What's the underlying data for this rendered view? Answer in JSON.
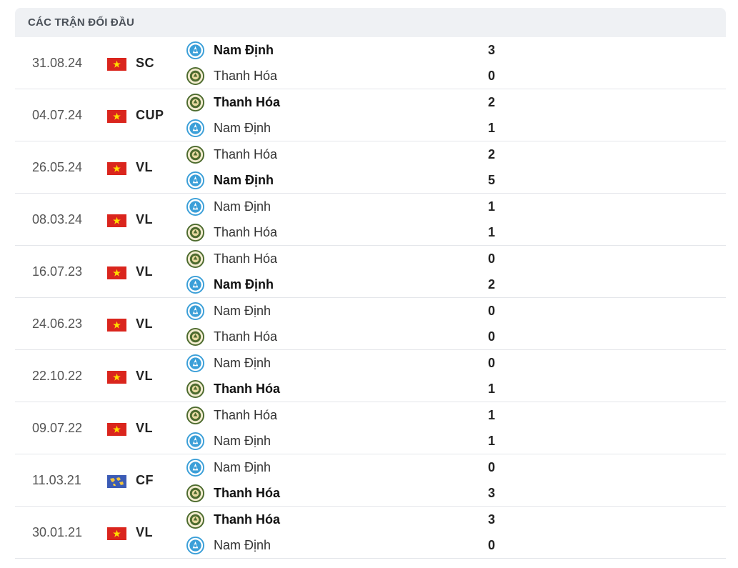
{
  "section": {
    "title": "CÁC TRẬN ĐỐI ĐẦU"
  },
  "teams": {
    "nam_dinh": {
      "name": "Nam Định",
      "logo_icon": "nam-dinh-logo-icon"
    },
    "thanh_hoa": {
      "name": "Thanh Hóa",
      "logo_icon": "thanh-hoa-logo-icon"
    }
  },
  "colors": {
    "vn_flag_red": "#da251d",
    "vn_flag_star": "#ffde00",
    "world_flag_blue": "#3b5bb5",
    "world_flag_gold": "#f2c53d",
    "nam_dinh_logo": "#3b9fd8",
    "thanh_hoa_logo": "#4d6b2e"
  },
  "matches": [
    {
      "date": "31.08.24",
      "flag": "vietnam-flag-icon",
      "competition": "SC",
      "home": {
        "team": "Nam Định",
        "logo": "nam_dinh",
        "score": "3",
        "winner": true
      },
      "away": {
        "team": "Thanh Hóa",
        "logo": "thanh_hoa",
        "score": "0",
        "winner": false
      }
    },
    {
      "date": "04.07.24",
      "flag": "vietnam-flag-icon",
      "competition": "CUP",
      "home": {
        "team": "Thanh Hóa",
        "logo": "thanh_hoa",
        "score": "2",
        "winner": true
      },
      "away": {
        "team": "Nam Định",
        "logo": "nam_dinh",
        "score": "1",
        "winner": false
      }
    },
    {
      "date": "26.05.24",
      "flag": "vietnam-flag-icon",
      "competition": "VL",
      "home": {
        "team": "Thanh Hóa",
        "logo": "thanh_hoa",
        "score": "2",
        "winner": false
      },
      "away": {
        "team": "Nam Định",
        "logo": "nam_dinh",
        "score": "5",
        "winner": true
      }
    },
    {
      "date": "08.03.24",
      "flag": "vietnam-flag-icon",
      "competition": "VL",
      "home": {
        "team": "Nam Định",
        "logo": "nam_dinh",
        "score": "1",
        "winner": false
      },
      "away": {
        "team": "Thanh Hóa",
        "logo": "thanh_hoa",
        "score": "1",
        "winner": false
      }
    },
    {
      "date": "16.07.23",
      "flag": "vietnam-flag-icon",
      "competition": "VL",
      "home": {
        "team": "Thanh Hóa",
        "logo": "thanh_hoa",
        "score": "0",
        "winner": false
      },
      "away": {
        "team": "Nam Định",
        "logo": "nam_dinh",
        "score": "2",
        "winner": true
      }
    },
    {
      "date": "24.06.23",
      "flag": "vietnam-flag-icon",
      "competition": "VL",
      "home": {
        "team": "Nam Định",
        "logo": "nam_dinh",
        "score": "0",
        "winner": false
      },
      "away": {
        "team": "Thanh Hóa",
        "logo": "thanh_hoa",
        "score": "0",
        "winner": false
      }
    },
    {
      "date": "22.10.22",
      "flag": "vietnam-flag-icon",
      "competition": "VL",
      "home": {
        "team": "Nam Định",
        "logo": "nam_dinh",
        "score": "0",
        "winner": false
      },
      "away": {
        "team": "Thanh Hóa",
        "logo": "thanh_hoa",
        "score": "1",
        "winner": true
      }
    },
    {
      "date": "09.07.22",
      "flag": "vietnam-flag-icon",
      "competition": "VL",
      "home": {
        "team": "Thanh Hóa",
        "logo": "thanh_hoa",
        "score": "1",
        "winner": false
      },
      "away": {
        "team": "Nam Định",
        "logo": "nam_dinh",
        "score": "1",
        "winner": false
      }
    },
    {
      "date": "11.03.21",
      "flag": "world-flag-icon",
      "competition": "CF",
      "home": {
        "team": "Nam Định",
        "logo": "nam_dinh",
        "score": "0",
        "winner": false
      },
      "away": {
        "team": "Thanh Hóa",
        "logo": "thanh_hoa",
        "score": "3",
        "winner": true
      }
    },
    {
      "date": "30.01.21",
      "flag": "vietnam-flag-icon",
      "competition": "VL",
      "home": {
        "team": "Thanh Hóa",
        "logo": "thanh_hoa",
        "score": "3",
        "winner": true
      },
      "away": {
        "team": "Nam Định",
        "logo": "nam_dinh",
        "score": "0",
        "winner": false
      }
    }
  ]
}
